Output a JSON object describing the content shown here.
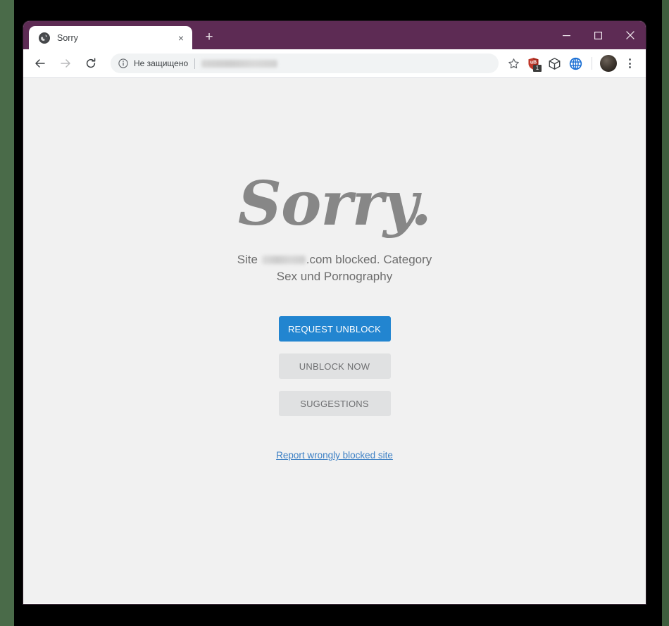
{
  "window": {
    "controls": {
      "minimize": "minimize-icon",
      "maximize": "maximize-icon",
      "close": "close-icon"
    }
  },
  "tabs": [
    {
      "title": "Sorry",
      "favicon": "globe-icon",
      "close_label": "×",
      "active": true
    }
  ],
  "new_tab_label": "+",
  "toolbar": {
    "back_icon": "back-arrow-icon",
    "forward_icon": "forward-arrow-icon",
    "reload_icon": "reload-icon",
    "security_icon": "info-circle-icon",
    "security_text": "Не защищено",
    "url_value": "",
    "url_placeholder": "",
    "bookmark_icon": "star-icon",
    "extensions": [
      {
        "name": "ublock-origin-icon",
        "label": "uB",
        "badge": "1",
        "color": "#b71c1c"
      },
      {
        "name": "package-box-icon",
        "label": "",
        "badge": "",
        "color": "#3c4043"
      },
      {
        "name": "blue-globe-icon",
        "label": "",
        "badge": "",
        "color": "#1a73e8"
      }
    ],
    "avatar": "profile-avatar",
    "menu_icon": "three-dot-menu-icon"
  },
  "page": {
    "logo_text": "Sorry.",
    "message_prefix": "Site ",
    "message_domain_redacted": true,
    "message_suffix": ".com blocked. Category Sex und Pornography",
    "buttons": [
      {
        "label": "REQUEST UNBLOCK",
        "style": "primary",
        "name": "request-unblock-button"
      },
      {
        "label": "UNBLOCK NOW",
        "style": "secondary",
        "name": "unblock-now-button"
      },
      {
        "label": "SUGGESTIONS",
        "style": "secondary",
        "name": "suggestions-button"
      }
    ],
    "report_link": "Report wrongly blocked site"
  },
  "colors": {
    "titlebar": "#5d2b54",
    "page_background": "#f1f1f1",
    "primary_button": "#2285d0",
    "secondary_button": "#e0e1e2",
    "link": "#3b7fc4",
    "logo_gray": "#878787",
    "desktop_strip": "#4a6b49"
  }
}
